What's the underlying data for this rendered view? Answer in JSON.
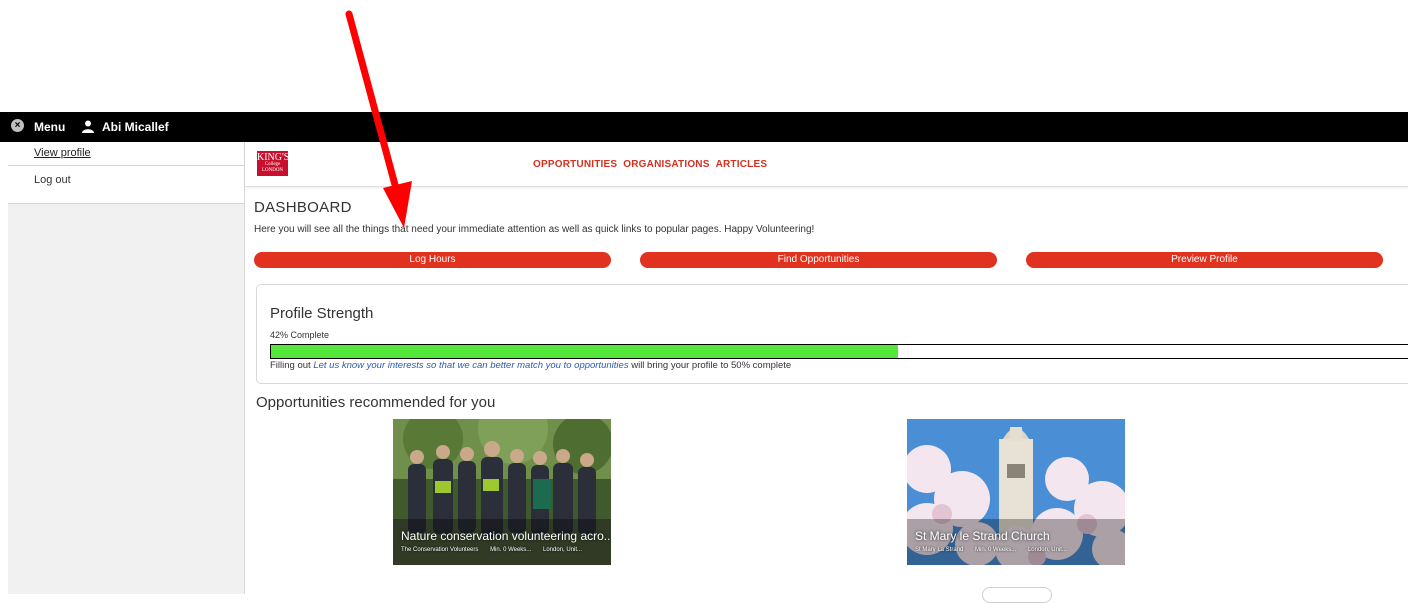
{
  "topbar": {
    "menu_label": "Menu",
    "user_name": "Abi Micallef"
  },
  "sidebar": {
    "items": [
      {
        "label": "View profile"
      },
      {
        "label": "Log out"
      }
    ]
  },
  "header": {
    "logo_line1": "KING'S",
    "logo_line2": "College LONDON",
    "nav": [
      {
        "label": "OPPORTUNITIES"
      },
      {
        "label": "ORGANISATIONS"
      },
      {
        "label": "ARTICLES"
      }
    ]
  },
  "dashboard": {
    "title": "DASHBOARD",
    "description": "Here you will see all the things that need your immediate attention as well as quick links to popular pages. Happy Volunteering!",
    "buttons": [
      {
        "label": "Log Hours"
      },
      {
        "label": "Find Opportunities"
      },
      {
        "label": "Preview Profile"
      }
    ]
  },
  "profile_strength": {
    "title": "Profile Strength",
    "complete_text": "42% Complete",
    "progress_fraction": 0.55,
    "note_prefix": "Filling out ",
    "note_link": "Let us know your interests so that we can better match you to opportunities",
    "note_suffix": " will bring your profile to 50% complete"
  },
  "recommended": {
    "title": "Opportunities recommended for you",
    "items": [
      {
        "caption": "Nature conservation volunteering acro...",
        "org": "The Conservation Volunteers",
        "commitment": "Min. 0 Weeks...",
        "location": "London, Unit..."
      },
      {
        "caption": "St Mary le Strand Church",
        "org": "St Mary La Strand",
        "commitment": "Min. 0 Weeks...",
        "location": "London, Unit..."
      }
    ]
  },
  "colors": {
    "brand_red": "#e0321f",
    "nav_red": "#d4311f",
    "progress_green": "#55e63b",
    "topbar": "#000000"
  }
}
